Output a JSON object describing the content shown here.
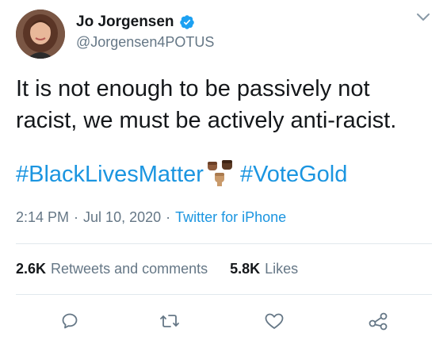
{
  "author": {
    "display_name": "Jo Jorgensen",
    "handle": "@Jorgensen4POTUS",
    "verified": true
  },
  "tweet": {
    "text": "It is not enough to be passively not racist, we must be actively anti-racist.",
    "hashtag_1": "#BlackLivesMatter",
    "hashtag_2": "#VoteGold",
    "emoji": "raised-fists-icon"
  },
  "meta": {
    "time": "2:14 PM",
    "separator": "·",
    "date": "Jul 10, 2020",
    "separator_2": "·",
    "source": "Twitter for iPhone"
  },
  "stats": {
    "retweets_count": "2.6K",
    "retweets_label": "Retweets and comments",
    "likes_count": "5.8K",
    "likes_label": "Likes"
  },
  "actions": [
    "reply-icon",
    "retweet-icon",
    "like-icon",
    "share-icon"
  ],
  "colors": {
    "link": "#1b95e0",
    "secondary_text": "#657786",
    "primary_text": "#14171a",
    "divider": "#e1e8ed"
  }
}
